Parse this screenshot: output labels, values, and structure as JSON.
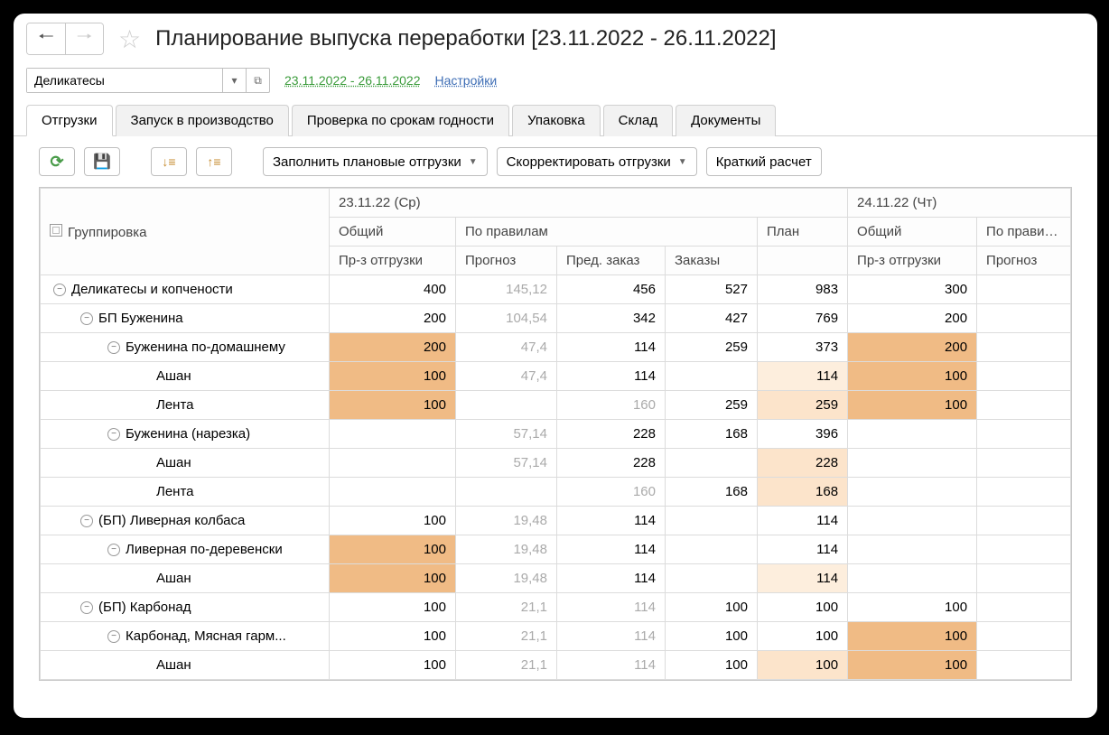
{
  "title": "Планирование выпуска переработки [23.11.2022 - 26.11.2022]",
  "combo_value": "Деликатесы",
  "date_range": "23.11.2022 - 26.11.2022",
  "settings_link": "Настройки",
  "tabs": {
    "shipments": "Отгрузки",
    "launch": "Запуск в производство",
    "expiry": "Проверка по срокам годности",
    "packing": "Упаковка",
    "warehouse": "Склад",
    "documents": "Документы"
  },
  "toolbar": {
    "fill": "Заполнить плановые отгрузки",
    "adjust": "Скорректировать отгрузки",
    "calc": "Краткий расчет"
  },
  "columns": {
    "grouping": "Группировка",
    "day1": "23.11.22 (Ср)",
    "day2": "24.11.22 (Чт)",
    "total": "Общий",
    "by_rules": "По правилам",
    "plan": "План",
    "forecast_ship": "Пр-з отгрузки",
    "forecast": "Прогноз",
    "prev_order": "Пред. заказ",
    "orders": "Заказы"
  },
  "rows": [
    {
      "indent": 0,
      "toggle": true,
      "label": "Деликатесы и копчености",
      "c1": "400",
      "c2": "145,12",
      "c3": "456",
      "c4": "527",
      "c5": "983",
      "c6": "300",
      "h": [
        "",
        "gray",
        "",
        "",
        "",
        "",
        ""
      ]
    },
    {
      "indent": 1,
      "toggle": true,
      "label": "БП Буженина",
      "c1": "200",
      "c2": "104,54",
      "c3": "342",
      "c4": "427",
      "c5": "769",
      "c6": "200",
      "h": [
        "",
        "gray",
        "",
        "",
        "",
        "",
        ""
      ]
    },
    {
      "indent": 2,
      "toggle": true,
      "label": "Буженина по-домашнему",
      "c1": "200",
      "c2": "47,4",
      "c3": "114",
      "c4": "259",
      "c5": "373",
      "c6": "200",
      "h": [
        "hl-orange",
        "gray",
        "",
        "",
        "",
        "hl-orange",
        ""
      ]
    },
    {
      "indent": 3,
      "toggle": false,
      "label": "Ашан",
      "c1": "100",
      "c2": "47,4",
      "c3": "114",
      "c4": "",
      "c5": "114",
      "c6": "100",
      "h": [
        "hl-orange",
        "gray",
        "",
        "",
        "hl-vlight",
        "hl-orange",
        ""
      ]
    },
    {
      "indent": 3,
      "toggle": false,
      "label": "Лента",
      "c1": "100",
      "c2": "",
      "c3": "160",
      "c4": "259",
      "c5": "259",
      "c6": "100",
      "h": [
        "hl-orange",
        "",
        "gray",
        "",
        "hl-light",
        "hl-orange",
        ""
      ]
    },
    {
      "indent": 2,
      "toggle": true,
      "label": "Буженина (нарезка)",
      "c1": "",
      "c2": "57,14",
      "c3": "228",
      "c4": "168",
      "c5": "396",
      "c6": "",
      "h": [
        "",
        "gray",
        "",
        "",
        "",
        "",
        ""
      ]
    },
    {
      "indent": 3,
      "toggle": false,
      "label": "Ашан",
      "c1": "",
      "c2": "57,14",
      "c3": "228",
      "c4": "",
      "c5": "228",
      "c6": "",
      "h": [
        "",
        "gray",
        "",
        "",
        "hl-light",
        "",
        ""
      ]
    },
    {
      "indent": 3,
      "toggle": false,
      "label": "Лента",
      "c1": "",
      "c2": "",
      "c3": "160",
      "c4": "168",
      "c5": "168",
      "c6": "",
      "h": [
        "",
        "",
        "gray",
        "",
        "hl-light",
        "",
        ""
      ]
    },
    {
      "indent": 1,
      "toggle": true,
      "label": "(БП) Ливерная колбаса",
      "c1": "100",
      "c2": "19,48",
      "c3": "114",
      "c4": "",
      "c5": "114",
      "c6": "",
      "h": [
        "",
        "gray",
        "",
        "",
        "",
        "",
        ""
      ]
    },
    {
      "indent": 2,
      "toggle": true,
      "label": "Ливерная по-деревенски",
      "c1": "100",
      "c2": "19,48",
      "c3": "114",
      "c4": "",
      "c5": "114",
      "c6": "",
      "h": [
        "hl-orange",
        "gray",
        "",
        "",
        "",
        "",
        ""
      ]
    },
    {
      "indent": 3,
      "toggle": false,
      "label": "Ашан",
      "c1": "100",
      "c2": "19,48",
      "c3": "114",
      "c4": "",
      "c5": "114",
      "c6": "",
      "h": [
        "hl-orange",
        "gray",
        "",
        "",
        "hl-vlight",
        "",
        ""
      ]
    },
    {
      "indent": 1,
      "toggle": true,
      "label": "(БП) Карбонад",
      "c1": "100",
      "c2": "21,1",
      "c3": "114",
      "c4": "100",
      "c5": "100",
      "c6": "100",
      "h": [
        "",
        "gray",
        "gray",
        "",
        "",
        "",
        ""
      ]
    },
    {
      "indent": 2,
      "toggle": true,
      "label": "Карбонад, Мясная гарм...",
      "c1": "100",
      "c2": "21,1",
      "c3": "114",
      "c4": "100",
      "c5": "100",
      "c6": "100",
      "h": [
        "",
        "gray",
        "gray",
        "",
        "",
        "hl-orange",
        ""
      ]
    },
    {
      "indent": 3,
      "toggle": false,
      "label": "Ашан",
      "c1": "100",
      "c2": "21,1",
      "c3": "114",
      "c4": "100",
      "c5": "100",
      "c6": "100",
      "h": [
        "",
        "gray",
        "gray",
        "",
        "hl-light",
        "hl-orange",
        ""
      ]
    }
  ]
}
